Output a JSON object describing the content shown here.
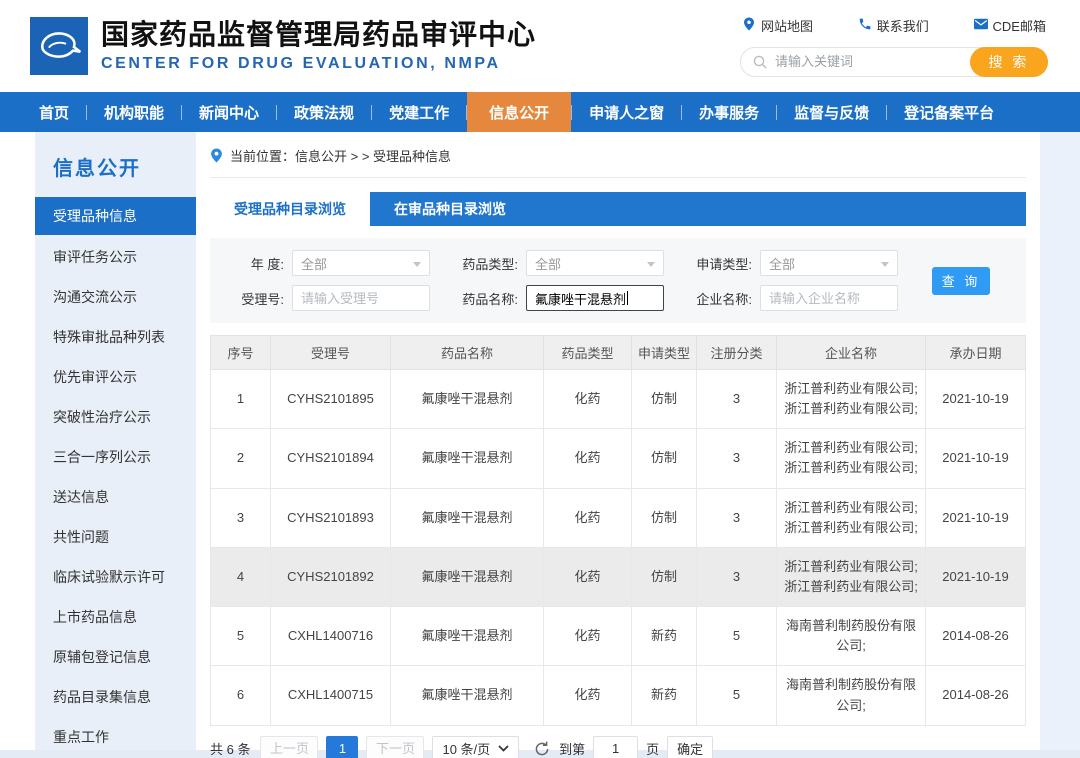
{
  "header": {
    "title": "国家药品监督管理局药品审评中心",
    "subtitle": "CENTER FOR DRUG EVALUATION, NMPA",
    "links": [
      {
        "icon": "location-pin-icon",
        "label": "网站地图"
      },
      {
        "icon": "phone-icon",
        "label": "联系我们"
      },
      {
        "icon": "mail-icon",
        "label": "CDE邮箱"
      }
    ],
    "search": {
      "placeholder": "请输入关键词",
      "button": "搜 索"
    }
  },
  "nav": {
    "items": [
      "首页",
      "机构职能",
      "新闻中心",
      "政策法规",
      "党建工作",
      "信息公开",
      "申请人之窗",
      "办事服务",
      "监督与反馈",
      "登记备案平台"
    ],
    "active_index": 5
  },
  "sidebar": {
    "title": "信息公开",
    "items": [
      "受理品种信息",
      "审评任务公示",
      "沟通交流公示",
      "特殊审批品种列表",
      "优先审评公示",
      "突破性治疗公示",
      "三合一序列公示",
      "送达信息",
      "共性问题",
      "临床试验默示许可",
      "上市药品信息",
      "原辅包登记信息",
      "药品目录集信息",
      "重点工作"
    ],
    "active_index": 0
  },
  "breadcrumb": {
    "text": "当前位置：信息公开 > >  受理品种信息"
  },
  "tabs": [
    {
      "label": "受理品种目录浏览",
      "active": true
    },
    {
      "label": "在审品种目录浏览",
      "active": false
    }
  ],
  "filters": {
    "year": {
      "label": "年  度:",
      "value": "全部"
    },
    "drug_type": {
      "label": "药品类型:",
      "value": "全部"
    },
    "apply_type": {
      "label": "申请类型:",
      "value": "全部"
    },
    "acceptance_no": {
      "label": "受理号:",
      "placeholder": "请输入受理号"
    },
    "drug_name": {
      "label": "药品名称:",
      "value": "氟康唑干混悬剂"
    },
    "company": {
      "label": "企业名称:",
      "placeholder": "请输入企业名称"
    },
    "query_button": "查 询"
  },
  "table": {
    "columns": [
      "序号",
      "受理号",
      "药品名称",
      "药品类型",
      "申请类型",
      "注册分类",
      "企业名称",
      "承办日期"
    ],
    "rows": [
      [
        "1",
        "CYHS2101895",
        "氟康唑干混悬剂",
        "化药",
        "仿制",
        "3",
        "浙江普利药业有限公司;浙江普利药业有限公司;",
        "2021-10-19"
      ],
      [
        "2",
        "CYHS2101894",
        "氟康唑干混悬剂",
        "化药",
        "仿制",
        "3",
        "浙江普利药业有限公司;浙江普利药业有限公司;",
        "2021-10-19"
      ],
      [
        "3",
        "CYHS2101893",
        "氟康唑干混悬剂",
        "化药",
        "仿制",
        "3",
        "浙江普利药业有限公司;浙江普利药业有限公司;",
        "2021-10-19"
      ],
      [
        "4",
        "CYHS2101892",
        "氟康唑干混悬剂",
        "化药",
        "仿制",
        "3",
        "浙江普利药业有限公司;浙江普利药业有限公司;",
        "2021-10-19"
      ],
      [
        "5",
        "CXHL1400716",
        "氟康唑干混悬剂",
        "化药",
        "新药",
        "5",
        "海南普利制药股份有限公司;",
        "2014-08-26"
      ],
      [
        "6",
        "CXHL1400715",
        "氟康唑干混悬剂",
        "化药",
        "新药",
        "5",
        "海南普利制药股份有限公司;",
        "2014-08-26"
      ]
    ],
    "highlighted_row": 3
  },
  "pagination": {
    "total": "共 6 条",
    "prev": "上一页",
    "current_page": "1",
    "next": "下一页",
    "page_size": "10 条/页",
    "goto_prefix": "到第",
    "goto_value": "1",
    "goto_suffix": "页",
    "confirm": "确定"
  },
  "colors": {
    "primary_blue": "#1c6fc6",
    "nav_active_orange": "#e5873c",
    "search_button_orange": "#f9a51d",
    "query_button_blue": "#2f9bf4",
    "pagination_active_blue": "#2479db",
    "sidebar_bg": "#e9eff8",
    "highlight_row_bg": "#ebebeb"
  }
}
